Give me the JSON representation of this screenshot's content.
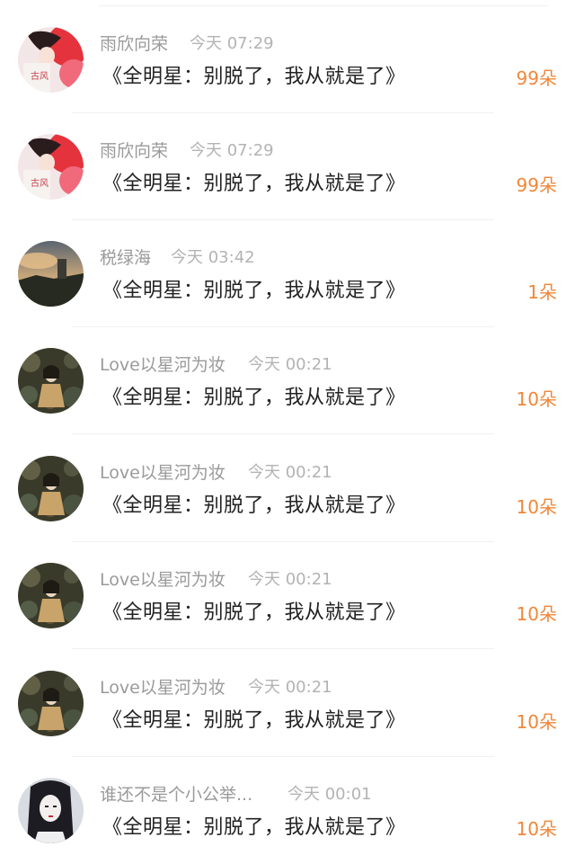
{
  "messages": [
    {
      "name": "雨欣向荣",
      "time": "今天 07:29",
      "title": "《全明星：别脱了，我从就是了》",
      "count": "99朵",
      "avatar": "avatar-girl-red"
    },
    {
      "name": "雨欣向荣",
      "time": "今天 07:29",
      "title": "《全明星：别脱了，我从就是了》",
      "count": "99朵",
      "avatar": "avatar-girl-red"
    },
    {
      "name": "税绿海",
      "time": "今天 03:42",
      "title": "《全明星：别脱了，我从就是了》",
      "count": "1朵",
      "avatar": "avatar-landscape"
    },
    {
      "name": "Love以星河为妆",
      "time": "今天 00:21",
      "title": "《全明星：别脱了，我从就是了》",
      "count": "10朵",
      "avatar": "avatar-bubbles"
    },
    {
      "name": "Love以星河为妆",
      "time": "今天 00:21",
      "title": "《全明星：别脱了，我从就是了》",
      "count": "10朵",
      "avatar": "avatar-bubbles"
    },
    {
      "name": "Love以星河为妆",
      "time": "今天 00:21",
      "title": "《全明星：别脱了，我从就是了》",
      "count": "10朵",
      "avatar": "avatar-bubbles"
    },
    {
      "name": "Love以星河为妆",
      "time": "今天 00:21",
      "title": "《全明星：别脱了，我从就是了》",
      "count": "10朵",
      "avatar": "avatar-bubbles"
    },
    {
      "name": "谁还不是个小公举...",
      "time": "今天 00:01",
      "title": "《全明星：别脱了，我从就是了》",
      "count": "10朵",
      "avatar": "avatar-girl-sketch"
    }
  ],
  "avatar_text": {
    "avatar-girl-red": "古风"
  }
}
